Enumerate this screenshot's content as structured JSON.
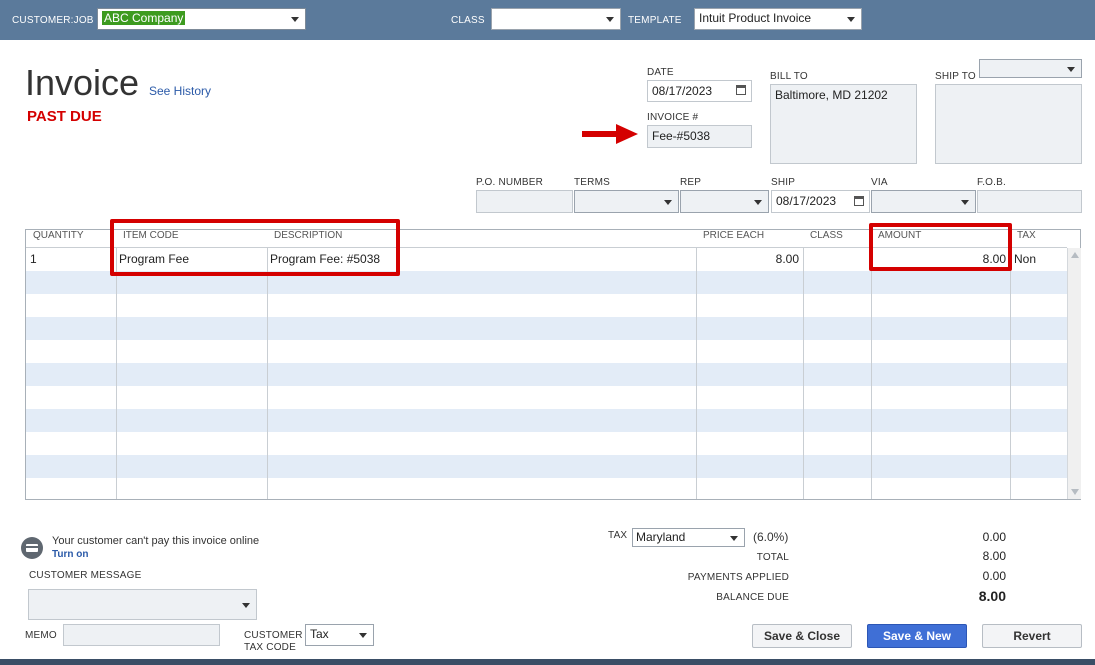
{
  "header": {
    "customer_job_label": "CUSTOMER:JOB",
    "customer_job_value": "ABC Company",
    "class_label": "CLASS",
    "class_value": "",
    "template_label": "TEMPLATE",
    "template_value": "Intuit Product Invoice"
  },
  "form": {
    "title": "Invoice",
    "see_history": "See History",
    "status": "PAST DUE",
    "date_label": "DATE",
    "date_value": "08/17/2023",
    "invoice_num_label": "INVOICE #",
    "invoice_num_value": "Fee-#5038",
    "bill_to_label": "BILL TO",
    "bill_to_value": "Baltimore, MD 21202",
    "ship_to_label": "SHIP TO",
    "ship_to_value": "",
    "po_number_label": "P.O. NUMBER",
    "terms_label": "TERMS",
    "rep_label": "REP",
    "ship_label": "SHIP",
    "ship_value": "08/17/2023",
    "via_label": "VIA",
    "fob_label": "F.O.B."
  },
  "grid": {
    "headers": {
      "quantity": "QUANTITY",
      "item_code": "ITEM CODE",
      "description": "DESCRIPTION",
      "price_each": "PRICE EACH",
      "class": "CLASS",
      "amount": "AMOUNT",
      "tax": "TAX"
    },
    "row1": {
      "quantity": "1",
      "item_code": "Program Fee",
      "description": "Program Fee: #5038",
      "price_each": "8.00",
      "class": "",
      "amount": "8.00",
      "tax": "Non"
    }
  },
  "footer": {
    "online_msg": "Your customer can't pay this invoice online",
    "turn_on": "Turn on",
    "customer_message_label": "CUSTOMER MESSAGE",
    "memo_label": "MEMO",
    "customer_tax_code_label_1": "CUSTOMER",
    "customer_tax_code_label_2": "TAX CODE",
    "customer_tax_code_value": "Tax",
    "tax_label": "TAX",
    "tax_value": "Maryland",
    "tax_rate": "(6.0%)",
    "tax_amount": "0.00",
    "total_label": "TOTAL",
    "total_value": "8.00",
    "payments_label": "PAYMENTS APPLIED",
    "payments_value": "0.00",
    "balance_label": "BALANCE DUE",
    "balance_value": "8.00"
  },
  "buttons": {
    "save_close": "Save & Close",
    "save_new": "Save & New",
    "revert": "Revert"
  },
  "colors": {
    "topbar": "#5b7a9b",
    "past_due": "#d40000",
    "highlight": "#d40000",
    "row_stripe": "#e3ecf7",
    "primary_button": "#3f6fd6"
  }
}
